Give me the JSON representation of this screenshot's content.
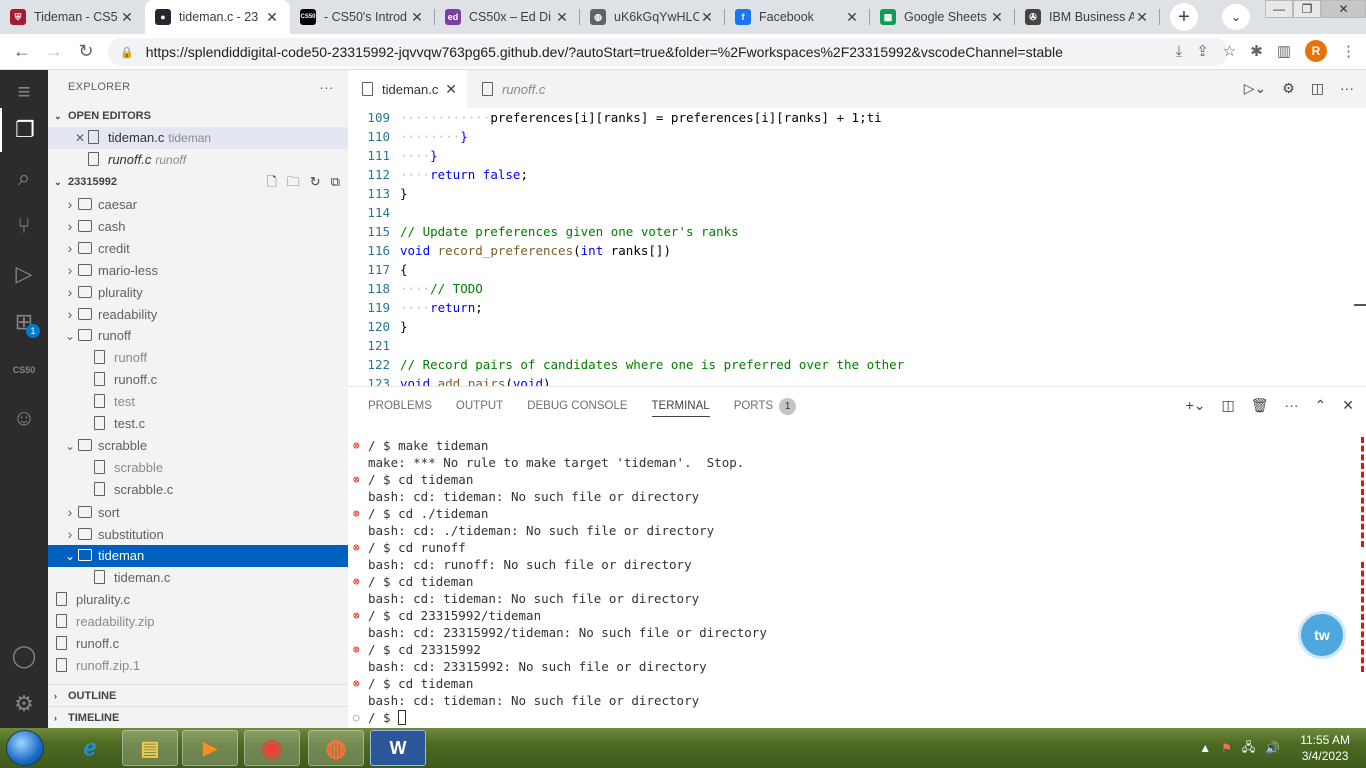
{
  "browser": {
    "tabs": [
      {
        "title": "Tideman - CS5",
        "fav_color": "#a51c30",
        "fav_glyph": "⛨"
      },
      {
        "title": "tideman.c - 23",
        "fav_color": "#24292f",
        "fav_glyph": "●",
        "active": true
      },
      {
        "title": "- CS50's Introd",
        "fav_color": "#000000",
        "fav_glyph": "CS50"
      },
      {
        "title": "CS50x – Ed Di",
        "fav_color": "#7b3fa0",
        "fav_glyph": "ed"
      },
      {
        "title": "uK6kGqYwHLC",
        "fav_color": "#5f6368",
        "fav_glyph": "◍"
      },
      {
        "title": "Facebook",
        "fav_color": "#1877f2",
        "fav_glyph": "f"
      },
      {
        "title": "Google Sheets",
        "fav_color": "#0f9d58",
        "fav_glyph": "▦"
      },
      {
        "title": "IBM Business A",
        "fav_color": "#444444",
        "fav_glyph": "✇"
      }
    ],
    "url": "https://splendiddigital-code50-23315992-jqvvqw763pg65.github.dev/?autoStart=true&folder=%2Fworkspaces%2F23315992&vscodeChannel=stable",
    "profile_initial": "R"
  },
  "explorer": {
    "title": "EXPLORER",
    "open_editors_label": "OPEN EDITORS",
    "open_editors": [
      {
        "name": "tideman.c",
        "desc": "tideman"
      },
      {
        "name": "runoff.c",
        "desc": "runoff"
      }
    ],
    "workspace_label": "23315992",
    "tree": [
      {
        "name": "caesar",
        "kind": "folder",
        "depth": 0,
        "open": false
      },
      {
        "name": "cash",
        "kind": "folder",
        "depth": 0,
        "open": false
      },
      {
        "name": "credit",
        "kind": "folder",
        "depth": 0,
        "open": false
      },
      {
        "name": "mario-less",
        "kind": "folder",
        "depth": 0,
        "open": false
      },
      {
        "name": "plurality",
        "kind": "folder",
        "depth": 0,
        "open": false
      },
      {
        "name": "readability",
        "kind": "folder",
        "depth": 0,
        "open": false
      },
      {
        "name": "runoff",
        "kind": "folder",
        "depth": 0,
        "open": true
      },
      {
        "name": "runoff",
        "kind": "file",
        "depth": 1,
        "dim": true
      },
      {
        "name": "runoff.c",
        "kind": "file",
        "depth": 1
      },
      {
        "name": "test",
        "kind": "file",
        "depth": 1,
        "dim": true
      },
      {
        "name": "test.c",
        "kind": "file",
        "depth": 1
      },
      {
        "name": "scrabble",
        "kind": "folder",
        "depth": 0,
        "open": true
      },
      {
        "name": "scrabble",
        "kind": "file",
        "depth": 1,
        "dim": true
      },
      {
        "name": "scrabble.c",
        "kind": "file",
        "depth": 1
      },
      {
        "name": "sort",
        "kind": "folder",
        "depth": 0,
        "open": false
      },
      {
        "name": "substitution",
        "kind": "folder",
        "depth": 0,
        "open": false
      },
      {
        "name": "tideman",
        "kind": "folder",
        "depth": 0,
        "open": true,
        "selected": true
      },
      {
        "name": "tideman.c",
        "kind": "file",
        "depth": 1
      },
      {
        "name": "plurality.c",
        "kind": "file",
        "depth": 0
      },
      {
        "name": "readability.zip",
        "kind": "file",
        "depth": 0,
        "dim": true
      },
      {
        "name": "runoff.c",
        "kind": "file",
        "depth": 0
      },
      {
        "name": "runoff.zip.1",
        "kind": "file",
        "depth": 0,
        "dim": true
      }
    ],
    "outline_label": "OUTLINE",
    "timeline_label": "TIMELINE"
  },
  "activity_bar": {
    "extensions_badge": "1",
    "cs50_label": "CS50"
  },
  "editor": {
    "tabs": [
      {
        "label": "tideman.c",
        "active": true
      },
      {
        "label": "runoff.c",
        "active": false
      }
    ],
    "lines": [
      {
        "n": "109",
        "ws": "············",
        "text": "preferences[i][ranks] = preferences[i][ranks] + 1;ti",
        "cls": "t"
      },
      {
        "n": "110",
        "ws": "········",
        "text": "}",
        "cls": "kw"
      },
      {
        "n": "111",
        "ws": "····",
        "text": "}",
        "cls": "kw"
      },
      {
        "n": "112",
        "ws": "····",
        "text": "return false;",
        "cls": "kw"
      },
      {
        "n": "113",
        "ws": "",
        "text": "}",
        "cls": "t"
      },
      {
        "n": "114",
        "ws": "",
        "text": "",
        "cls": "t"
      },
      {
        "n": "115",
        "ws": "",
        "text": "// Update preferences given one voter's ranks",
        "cls": "cm"
      },
      {
        "n": "116",
        "ws": "",
        "text": "void record_preferences(int ranks[])",
        "cls": "t"
      },
      {
        "n": "117",
        "ws": "",
        "text": "{",
        "cls": "t"
      },
      {
        "n": "118",
        "ws": "····",
        "text": "// TODO",
        "cls": "cm"
      },
      {
        "n": "119",
        "ws": "····",
        "text": "return;",
        "cls": "kw"
      },
      {
        "n": "120",
        "ws": "",
        "text": "}",
        "cls": "t"
      },
      {
        "n": "121",
        "ws": "",
        "text": "",
        "cls": "t"
      },
      {
        "n": "122",
        "ws": "",
        "text": "// Record pairs of candidates where one is preferred over the other",
        "cls": "cm"
      },
      {
        "n": "123",
        "ws": "",
        "text": "void add_pairs(void)",
        "cls": "t"
      }
    ]
  },
  "panel": {
    "tabs": [
      "PROBLEMS",
      "OUTPUT",
      "DEBUG CONSOLE",
      "TERMINAL",
      "PORTS"
    ],
    "active_tab": "TERMINAL",
    "ports_badge": "1",
    "terminal_lines": [
      {
        "mark": "err",
        "text": "/ $ make tideman"
      },
      {
        "mark": "",
        "text": "make: *** No rule to make target 'tideman'.  Stop."
      },
      {
        "mark": "err",
        "text": "/ $ cd tideman"
      },
      {
        "mark": "",
        "text": "bash: cd: tideman: No such file or directory"
      },
      {
        "mark": "err",
        "text": "/ $ cd ./tideman"
      },
      {
        "mark": "",
        "text": "bash: cd: ./tideman: No such file or directory"
      },
      {
        "mark": "err",
        "text": "/ $ cd runoff"
      },
      {
        "mark": "",
        "text": "bash: cd: runoff: No such file or directory"
      },
      {
        "mark": "err",
        "text": "/ $ cd tideman"
      },
      {
        "mark": "",
        "text": "bash: cd: tideman: No such file or directory"
      },
      {
        "mark": "err",
        "text": "/ $ cd 23315992/tideman"
      },
      {
        "mark": "",
        "text": "bash: cd: 23315992/tideman: No such file or directory"
      },
      {
        "mark": "err",
        "text": "/ $ cd 23315992"
      },
      {
        "mark": "",
        "text": "bash: cd: 23315992: No such file or directory"
      },
      {
        "mark": "err",
        "text": "/ $ cd tideman"
      },
      {
        "mark": "",
        "text": "bash: cd: tideman: No such file or directory"
      }
    ],
    "prompt": "/ $ ",
    "floating_label": "tw"
  },
  "taskbar": {
    "time": "11:55 AM",
    "date": "3/4/2023"
  }
}
